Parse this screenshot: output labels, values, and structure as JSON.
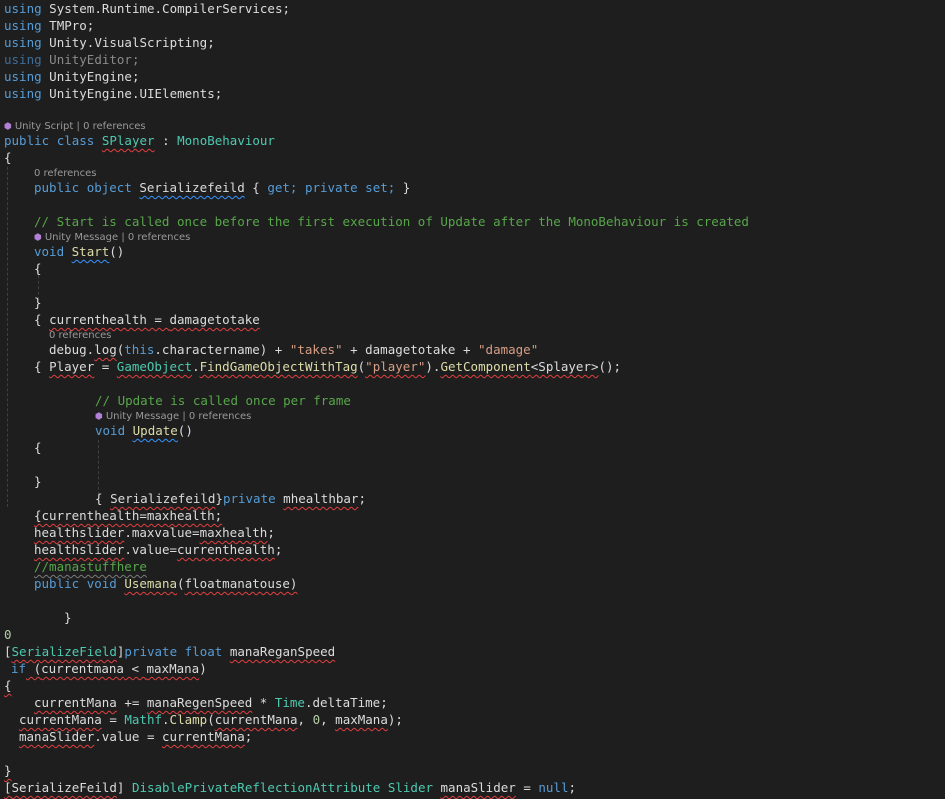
{
  "code": {
    "usings": [
      {
        "keyword": "using",
        "ns": "System.Runtime.CompilerServices;"
      },
      {
        "keyword": "using",
        "ns": "TMPro;"
      },
      {
        "keyword": "using",
        "ns": "Unity.VisualScripting;"
      },
      {
        "keyword": "using",
        "ns": "UnityEditor;"
      },
      {
        "keyword": "using",
        "ns": "UnityEngine;"
      },
      {
        "keyword": "using",
        "ns": "UnityEngine.UIElements;"
      }
    ],
    "lens_class": {
      "kind": "Unity Script",
      "refs": "0 references"
    },
    "class_decl": {
      "kw1": "public",
      "kw2": "class",
      "name": "SPlayer",
      "colon": " : ",
      "base": "MonoBehaviour"
    },
    "open_brace": "{",
    "lens_prop": "0 references",
    "prop_line": {
      "kw1": "public",
      "kw2": "object",
      "name": "Serializefeild",
      "open": " { ",
      "get": "get;",
      "priv": "private",
      "set": "set;",
      "close": " }"
    },
    "comment_start": "// Start is called once before the first execution of Update after the MonoBehaviour is created",
    "lens_start": {
      "kind": "Unity Message",
      "refs": "0 references"
    },
    "start_decl": {
      "kw": "void",
      "name": "Start",
      "parens": "()"
    },
    "brace_open": "{",
    "brace_close": "}",
    "health_line": {
      "brace": "{ ",
      "lhs": "currenthealth",
      "op": " = ",
      "rhs": "damagetotake"
    },
    "lens_debug": "0 references",
    "debug_line": {
      "obj": "debug",
      "dot": ".",
      "fn": "log",
      "open": "(",
      "this": "this",
      "mid": ".charactername) + ",
      "s1": "\"takes\"",
      "p1": " + damagetotake + ",
      "s2": "\"damage\""
    },
    "player_line": {
      "brace": "{ ",
      "var": "Player",
      "eq": " = ",
      "cls": "GameObject",
      "dot": ".",
      "fn": "FindGameObjectWithTag",
      "open": "(",
      "s": "\"player\"",
      "close": ").",
      "fn2": "GetComponent",
      "gen": "<Splayer>",
      "end": "();"
    },
    "comment_update": "// Update is called once per frame",
    "lens_update": {
      "kind": "Unity Message",
      "refs": "0 references"
    },
    "update_decl": {
      "kw": "void",
      "name": "Update",
      "parens": "()"
    },
    "field_line": {
      "open": "{ ",
      "attr": "Serializefeild",
      "close": "}",
      "kw": "private",
      "name": "mhealthbar",
      "semi": ";"
    },
    "assign1": "{currenthealth=maxhealth;",
    "assign2": {
      "a": "healthslider",
      "b": ".maxvalue=",
      "c": "maxhealth",
      "d": ";"
    },
    "assign3": {
      "a": "healthslider",
      "b": ".value=",
      "c": "currenthealth",
      "d": ";"
    },
    "comment_mana": "//manastuffhere",
    "usemana_line": {
      "kw1": "public",
      "kw2": "void",
      "name": "Usemana",
      "open": "(",
      "param": "floatmanatouse",
      "close": ")"
    },
    "inner_close": "}",
    "zero": "0",
    "serial_line": {
      "open": "[",
      "attr": "SerializeField",
      "close": "]",
      "kw1": "private",
      "kw2": "float",
      "name": "manaReganSpeed"
    },
    "if_line": {
      "kw": "if",
      "open": " (",
      "a": "currentmana",
      "op": " < ",
      "b": "maxMana",
      "close": ")"
    },
    "outer_open": "{",
    "regen_line": {
      "a": "currentMana",
      "op": " += ",
      "b": "manaRegenSpeed",
      "mul": " * ",
      "cls": "Time",
      "rest": ".deltaTime;"
    },
    "clamp_line": {
      "a": "currentMana",
      "eq": " = ",
      "cls": "Mathf",
      "dot": ".",
      "fn": "Clamp",
      "open": "(",
      "b": "currentMana",
      "c1": ", ",
      "zero": "0",
      "c2": ", ",
      "c": "maxMana",
      "end": ");"
    },
    "slider_line": {
      "a": "manaSlider",
      "b": ".value = ",
      "c": "currentMana",
      "d": ";"
    },
    "outer_close": "}",
    "last_line": {
      "open": "[",
      "attr": "SerializeFeild",
      "close": "] ",
      "t1": "DisablePrivateReflectionAttribute",
      "sp": " ",
      "t2": "Slider",
      "sp2": " ",
      "name": "manaSlider",
      "eq": " = ",
      "null": "null",
      "semi": ";"
    }
  }
}
